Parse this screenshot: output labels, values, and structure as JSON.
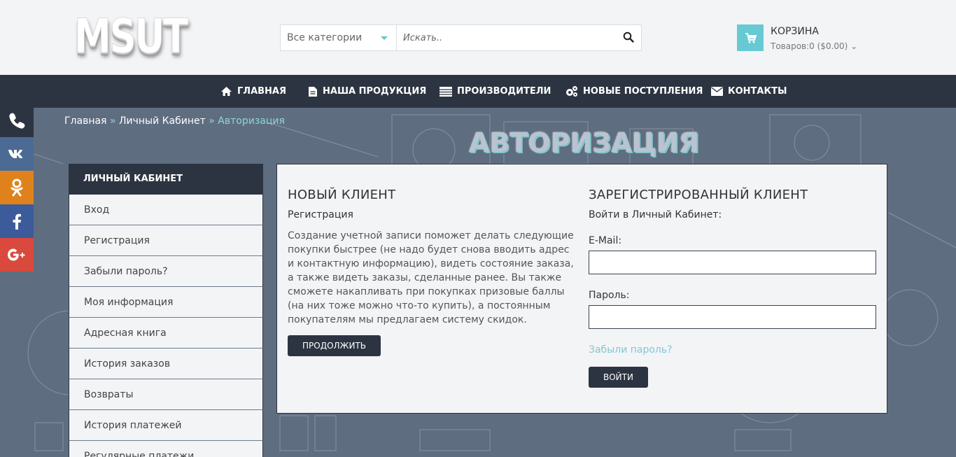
{
  "logo": {
    "text": "MSUT"
  },
  "search": {
    "category_selected": "Все категории",
    "placeholder": "Искать..",
    "value": ""
  },
  "cart": {
    "title": "КОРЗИНА",
    "summary": "Товаров:0 ($0.00)"
  },
  "nav": {
    "items": [
      {
        "label": "ГЛАВНАЯ",
        "icon": "home-icon"
      },
      {
        "label": "НАША ПРОДУКЦИЯ",
        "icon": "document-icon"
      },
      {
        "label": "ПРОИЗВОДИТЕЛИ",
        "icon": "list-icon"
      },
      {
        "label": "НОВЫЕ ПОСТУПЛЕНИЯ",
        "icon": "gears-icon"
      },
      {
        "label": "КОНТАКТЫ",
        "icon": "envelope-icon"
      }
    ]
  },
  "breadcrumb": {
    "home": "Главная",
    "account": "Личный Кабинет",
    "sep": "»",
    "current": "Авторизация"
  },
  "page_title": "АВТОРИЗАЦИЯ",
  "social": [
    {
      "icon": "phone-icon",
      "color": "#2c3441"
    },
    {
      "icon": "vk-icon",
      "color": "#4b6b94"
    },
    {
      "icon": "odnoklassniki-icon",
      "color": "#e0821c"
    },
    {
      "icon": "facebook-icon",
      "color": "#3b5b9a"
    },
    {
      "icon": "google-plus-icon",
      "color": "#d9493d"
    }
  ],
  "sidebar": {
    "title": "ЛИЧНЫЙ КАБИНЕТ",
    "items": [
      "Вход",
      "Регистрация",
      "Забыли пароль?",
      "Моя информация",
      "Адресная книга",
      "История заказов",
      "Возвраты",
      "История платежей",
      "Регулярные платежи"
    ]
  },
  "new_customer": {
    "title": "НОВЫЙ КЛИЕНТ",
    "subtitle": "Регистрация",
    "text": "Создание учетной записи поможет делать следующие покупки быстрее (не надо будет снова вводить адрес и контактную информацию), видеть состояние заказа, а также видеть заказы, сделанные ранее. Вы также сможете накапливать при покупках призовые баллы (на них тоже можно что-то купить), а постоянным покупателям мы предлагаем систему скидок.",
    "button": "ПРОДОЛЖИТЬ"
  },
  "returning_customer": {
    "title": "ЗАРЕГИСТРИРОВАННЫЙ КЛИЕНТ",
    "subtitle": "Войти в Личный Кабинет:",
    "email_label": "E-Mail:",
    "email_value": "",
    "password_label": "Пароль:",
    "password_value": "",
    "forgot": "Забыли пароль?",
    "button": "ВОЙТИ"
  },
  "colors": {
    "dark": "#2c3441",
    "accent": "#66c9d3",
    "background": "#5e6e80"
  }
}
